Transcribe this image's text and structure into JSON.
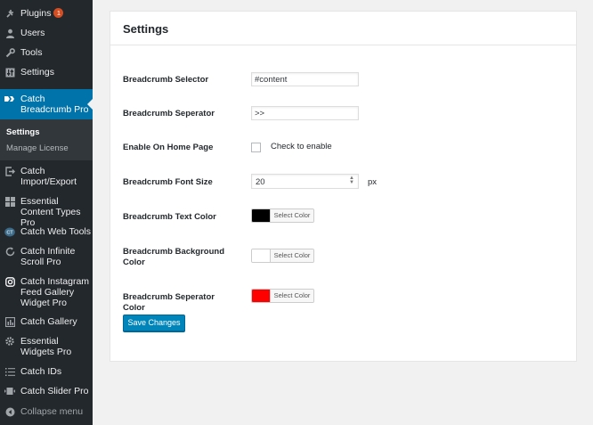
{
  "sidebar": {
    "items": [
      {
        "id": "plugins",
        "label": "Plugins",
        "icon": "plug-icon",
        "badge": "1"
      },
      {
        "id": "users",
        "label": "Users",
        "icon": "user-icon"
      },
      {
        "id": "tools",
        "label": "Tools",
        "icon": "wrench-icon"
      },
      {
        "id": "settings",
        "label": "Settings",
        "icon": "settings-sliders-icon"
      },
      {
        "id": "catch-breadcrumb-pro",
        "label": "Catch Breadcrumb Pro",
        "icon": "breadcrumb-icon",
        "active": true
      },
      {
        "id": "catch-import-export",
        "label": "Catch Import/Export",
        "icon": "import-export-icon"
      },
      {
        "id": "essential-content-types-pro",
        "label": "Essential Content Types Pro",
        "icon": "grid-icon"
      },
      {
        "id": "catch-web-tools",
        "label": "Catch Web Tools",
        "icon": "ct-logo-icon"
      },
      {
        "id": "catch-infinite-scroll-pro",
        "label": "Catch Infinite Scroll Pro",
        "icon": "refresh-icon"
      },
      {
        "id": "catch-instagram-feed-gallery-widget-pro",
        "label": "Catch Instagram Feed Gallery Widget Pro",
        "icon": "instagram-icon"
      },
      {
        "id": "catch-gallery",
        "label": "Catch Gallery",
        "icon": "gallery-icon"
      },
      {
        "id": "essential-widgets-pro",
        "label": "Essential Widgets Pro",
        "icon": "gear-icon"
      },
      {
        "id": "catch-ids",
        "label": "Catch IDs",
        "icon": "list-icon"
      },
      {
        "id": "catch-slider-pro",
        "label": "Catch Slider Pro",
        "icon": "slider-icon"
      },
      {
        "id": "collapse-menu",
        "label": "Collapse menu",
        "icon": "collapse-icon"
      }
    ],
    "submenu": [
      {
        "label": "Settings",
        "current": true
      },
      {
        "label": "Manage License",
        "current": false
      }
    ]
  },
  "page": {
    "title": "Settings"
  },
  "form": {
    "breadcrumb_selector": {
      "label": "Breadcrumb Selector",
      "value": "#content"
    },
    "breadcrumb_separator": {
      "label": "Breadcrumb Seperator",
      "value": ">>"
    },
    "enable_home": {
      "label": "Enable On Home Page",
      "checkbox_label": "Check to enable",
      "checked": false
    },
    "font_size": {
      "label": "Breadcrumb Font Size",
      "value": "20",
      "unit": "px"
    },
    "text_color": {
      "label": "Breadcrumb Text Color",
      "button_label": "Select Color",
      "color": "#000000"
    },
    "background_color": {
      "label": "Breadcrumb Background Color",
      "button_label": "Select Color",
      "color": "#ffffff"
    },
    "separator_color": {
      "label": "Breadcrumb Seperator Color",
      "button_label": "Select Color",
      "color": "#ff0000"
    },
    "save_label": "Save Changes"
  },
  "colors": {
    "sidebar_bg": "#23282d",
    "active_bg": "#0073aa",
    "primary_button": "#0085ba"
  }
}
